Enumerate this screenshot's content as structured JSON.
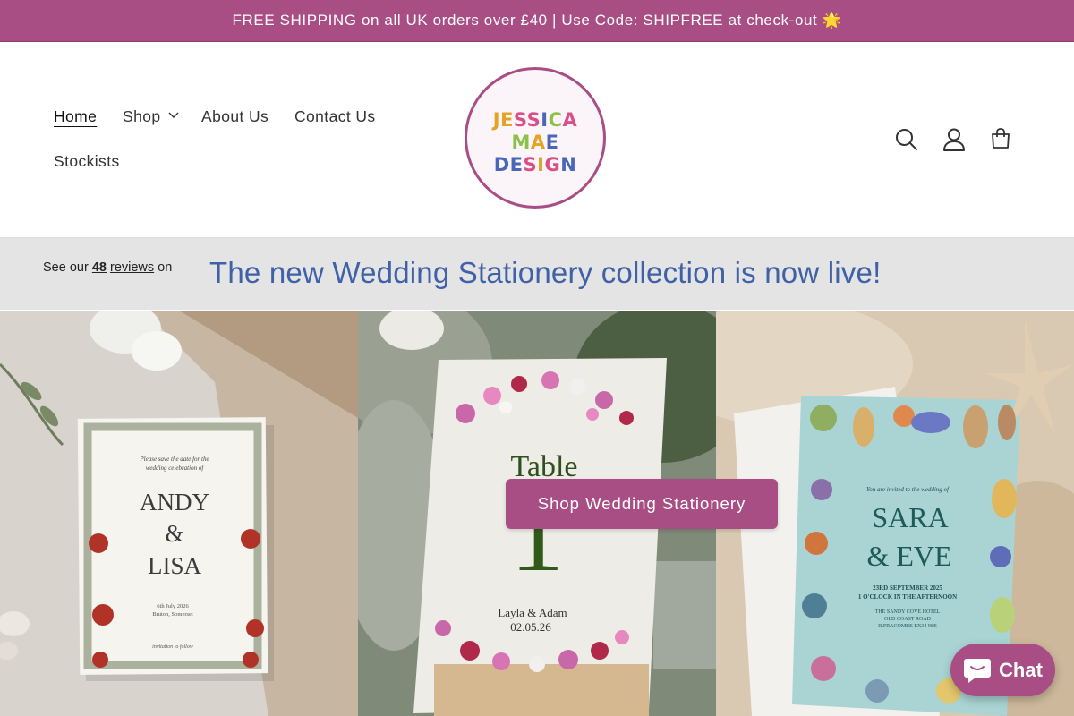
{
  "announcement": {
    "text": "FREE SHIPPING on all UK orders over £40 | Use Code: SHIPFREE at check-out 🌟"
  },
  "nav": {
    "items": [
      {
        "label": "Home"
      },
      {
        "label": "Shop"
      },
      {
        "label": "About Us"
      },
      {
        "label": "Contact Us"
      },
      {
        "label": "Stockists"
      }
    ]
  },
  "logo": {
    "lines": [
      "JESSICA",
      "MAE",
      "DESIGN"
    ]
  },
  "header_icons": [
    "search-icon",
    "account-icon",
    "cart-icon"
  ],
  "reviews": {
    "prefix": "See our ",
    "count": "48",
    "link": "reviews",
    "suffix": " on"
  },
  "banner": {
    "text": "The new Wedding Stationery collection is now live!"
  },
  "hero": {
    "cta_label": "Shop Wedding Stationery",
    "cards": {
      "left": {
        "intro1": "Please save the date for the",
        "intro2": "wedding celebration of",
        "name1": "ANDY",
        "amp": "&",
        "name2": "LISA",
        "date": "6th July 2026",
        "place": "Bruton, Somerset",
        "footer": "invitation to follow"
      },
      "middle": {
        "title": "Table",
        "number": "1",
        "names": "Layla & Adam",
        "date": "02.05.26"
      },
      "right": {
        "intro": "You are invited to the wedding of",
        "name1": "SARA",
        "name2": "& EVE",
        "line1": "23RD SEPTEMBER 2025",
        "line2": "1 O'CLOCK IN THE AFTERNOON",
        "line3": "THE SANDY COVE HOTEL",
        "line4": "OLD COAST ROAD",
        "line5": "ILFRACOMBE EX34 9SE"
      }
    }
  },
  "chat": {
    "label": "Chat"
  },
  "colors": {
    "brand": "#a84e84",
    "banner_text": "#3f61a8"
  }
}
